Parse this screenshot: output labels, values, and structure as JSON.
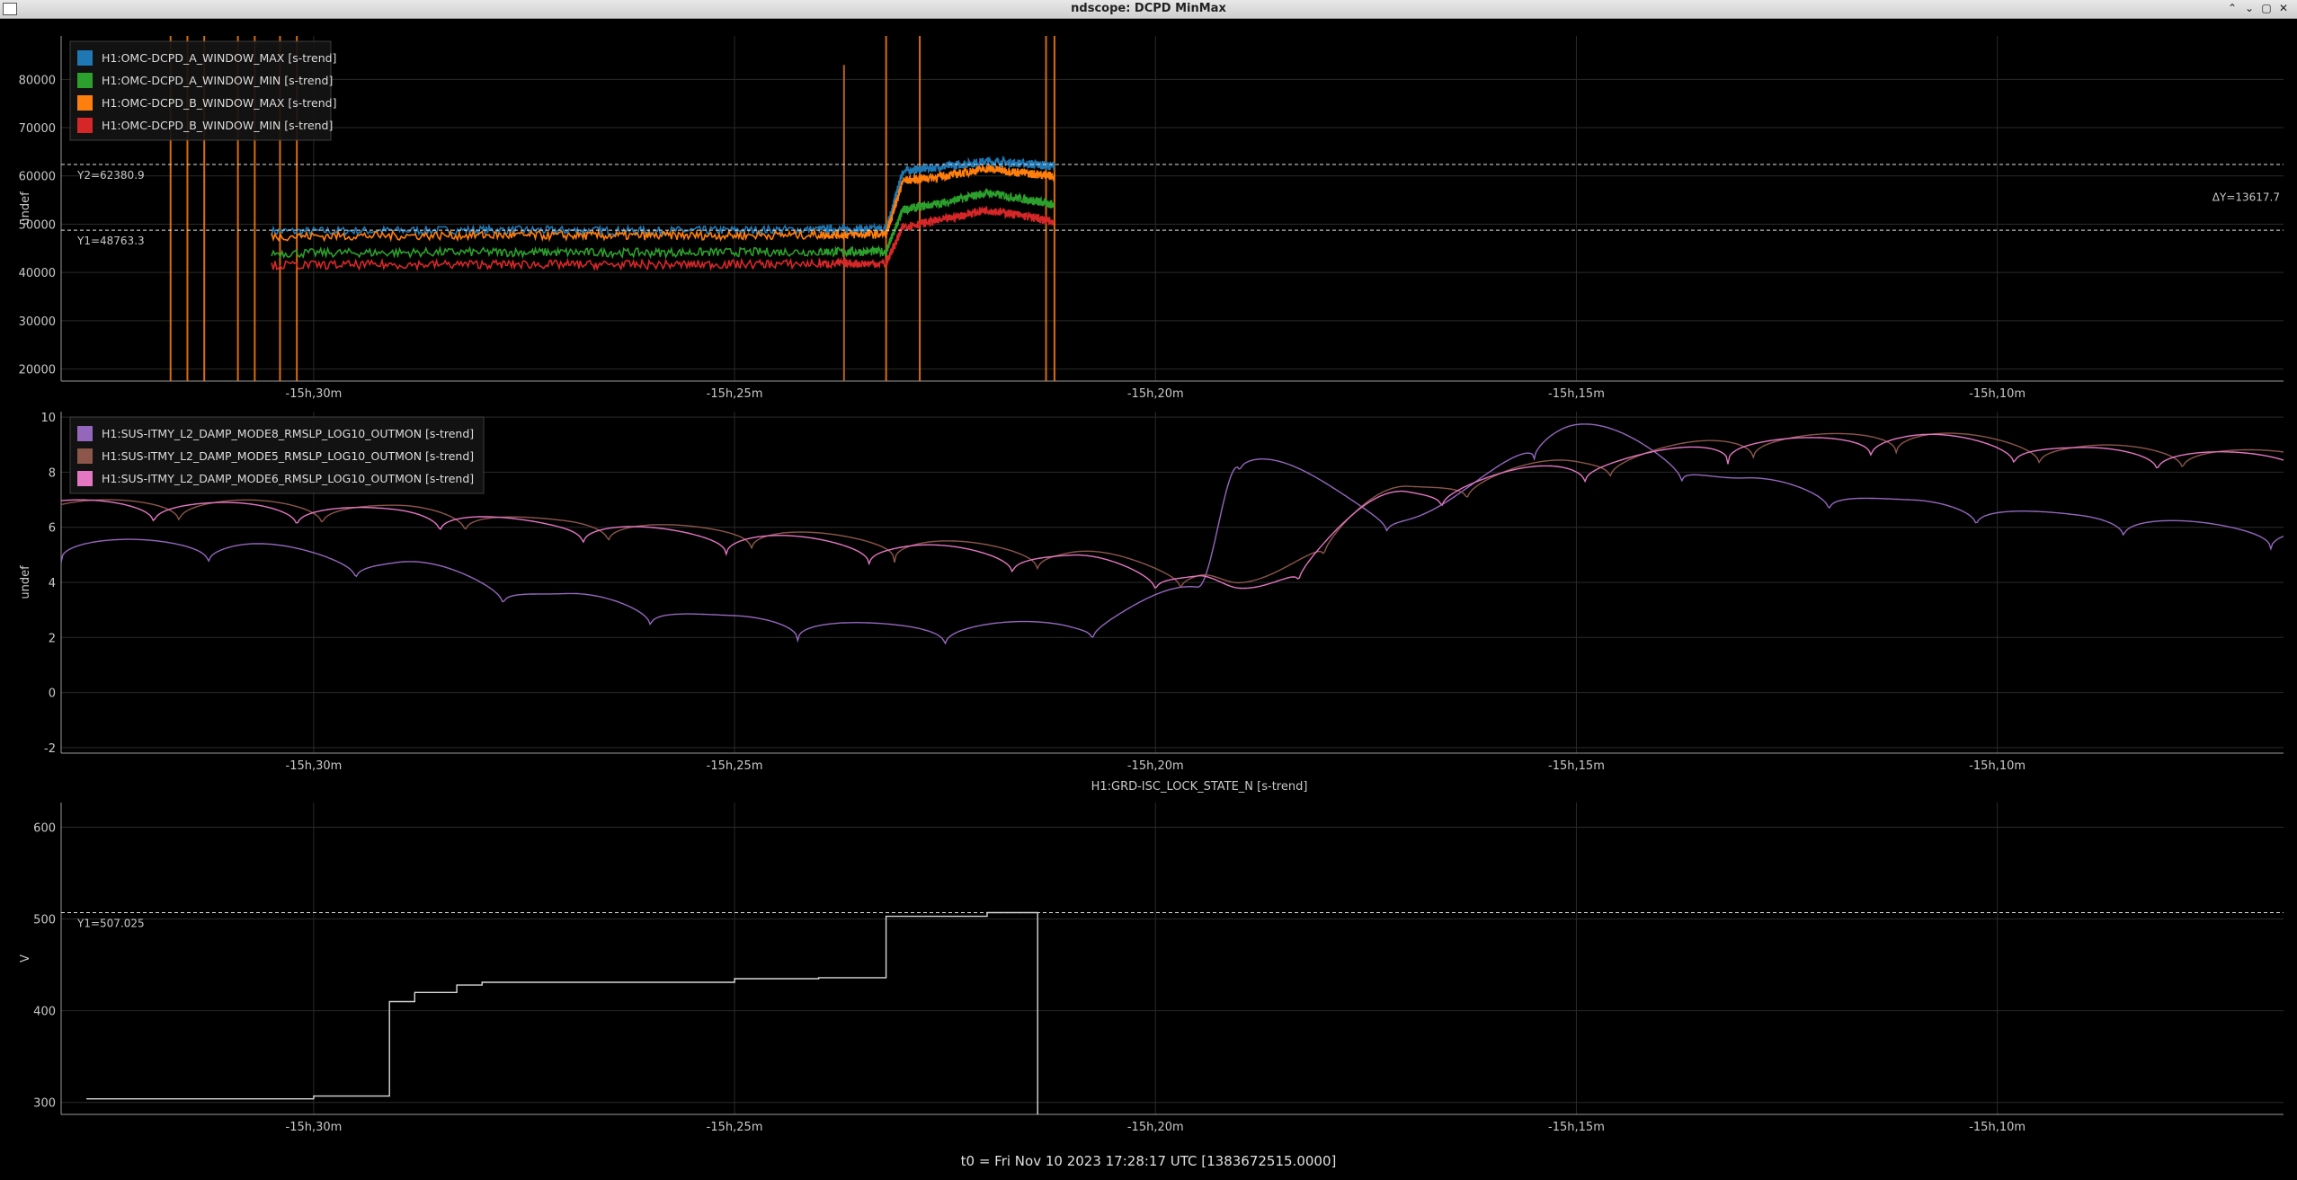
{
  "window": {
    "title": "ndscope: DCPD MinMax",
    "buttons": [
      "⌃",
      "⌄",
      "▢",
      "✕"
    ]
  },
  "footer": {
    "t0_text": "t0 = Fri Nov 10 2023 17:28:17 UTC [1383672515.0000]"
  },
  "colors": {
    "background": "#000000",
    "grid": "#2a2a2a",
    "axis": "#9a9a9a",
    "blue": "#1f77b4",
    "green": "#2ca02c",
    "orange": "#ff7f0e",
    "red": "#d62728",
    "purple": "#9467bd",
    "brown": "#8c564b",
    "pink": "#e377c2",
    "white": "#d8d8d8"
  },
  "chart_data": [
    {
      "type": "line",
      "title": "",
      "ylabel": "undef",
      "xlim_min": [
        -33.0,
        -6.6
      ],
      "ylim": [
        17500,
        89000
      ],
      "yticks": [
        20000,
        30000,
        40000,
        50000,
        60000,
        70000,
        80000
      ],
      "xticks": [
        {
          "v": -30,
          "label": "-15h,30m"
        },
        {
          "v": -25,
          "label": "-15h,25m"
        },
        {
          "v": -20,
          "label": "-15h,20m"
        },
        {
          "v": -15,
          "label": "-15h,15m"
        },
        {
          "v": -10,
          "label": "-15h,10m"
        }
      ],
      "legend": "top-left",
      "cursors": [
        {
          "y": 62380.9,
          "label": "Y2=62380.9"
        },
        {
          "y": 48763.3,
          "label": "Y1=48763.3"
        }
      ],
      "delta_label": "ΔY=13617.7",
      "series": [
        {
          "name": "H1:OMC-DCPD_A_WINDOW_MAX [s-trend]",
          "color": "#1f77b4",
          "x": [
            -30.5,
            -28,
            -26,
            -24,
            -23.2,
            -23.0,
            -22.5,
            -22,
            -21.5,
            -21.2
          ],
          "y": [
            48500,
            48800,
            48600,
            48900,
            49000,
            61000,
            62000,
            63000,
            62500,
            62000
          ]
        },
        {
          "name": "H1:OMC-DCPD_A_WINDOW_MIN [s-trend]",
          "color": "#2ca02c",
          "x": [
            -30.5,
            -28,
            -26,
            -24,
            -23.2,
            -23.0,
            -22.5,
            -22,
            -21.5,
            -21.2
          ],
          "y": [
            44000,
            44200,
            44100,
            44300,
            44300,
            53000,
            54500,
            56500,
            55000,
            54000
          ]
        },
        {
          "name": "H1:OMC-DCPD_B_WINDOW_MAX [s-trend]",
          "color": "#ff7f0e",
          "x": [
            -30.5,
            -28,
            -26,
            -24,
            -23.2,
            -23.0,
            -22.5,
            -22,
            -21.5,
            -21.2
          ],
          "y": [
            47500,
            47700,
            47600,
            47800,
            47900,
            59000,
            60000,
            61500,
            60500,
            60000
          ]
        },
        {
          "name": "H1:OMC-DCPD_B_WINDOW_MIN [s-trend]",
          "color": "#d62728",
          "x": [
            -30.5,
            -28,
            -26,
            -24,
            -23.2,
            -23.0,
            -22.5,
            -22,
            -21.5,
            -21.2
          ],
          "y": [
            41500,
            41700,
            41600,
            41800,
            41900,
            49500,
            51000,
            53000,
            51500,
            50500
          ]
        }
      ]
    },
    {
      "type": "line",
      "title": "",
      "ylabel": "undef",
      "xlim_min": [
        -33.0,
        -6.6
      ],
      "ylim": [
        -2.2,
        10.2
      ],
      "yticks": [
        -2,
        0,
        2,
        4,
        6,
        8,
        10
      ],
      "xticks": [
        {
          "v": -30,
          "label": "-15h,30m"
        },
        {
          "v": -25,
          "label": "-15h,25m"
        },
        {
          "v": -20,
          "label": "-15h,20m"
        },
        {
          "v": -15,
          "label": "-15h,15m"
        },
        {
          "v": -10,
          "label": "-15h,10m"
        }
      ],
      "legend": "top-left",
      "series": [
        {
          "name": "H1:SUS-ITMY_L2_DAMP_MODE8_RMSLP_LOG10_OUTMON [s-trend]",
          "color": "#9467bd",
          "x": [
            -33,
            -31,
            -29,
            -27,
            -25,
            -23,
            -21,
            -19.5,
            -19.0,
            -17,
            -15,
            -13,
            -11,
            -9,
            -6.6
          ],
          "y": [
            5.6,
            5.5,
            4.8,
            3.6,
            2.8,
            2.5,
            2.6,
            3.9,
            8.8,
            6.5,
            9.8,
            7.8,
            7.0,
            6.5,
            6.0
          ]
        },
        {
          "name": "H1:SUS-ITMY_L2_DAMP_MODE5_RMSLP_LOG10_OUTMON [s-trend]",
          "color": "#8c564b",
          "x": [
            -33,
            -31,
            -29,
            -27,
            -25,
            -23,
            -21,
            -19.5,
            -19.0,
            -17,
            -15,
            -13,
            -11,
            -9,
            -6.6
          ],
          "y": [
            7.0,
            7.0,
            6.8,
            6.3,
            6.0,
            5.6,
            5.2,
            4.5,
            4.0,
            7.5,
            8.5,
            9.3,
            9.5,
            9.0,
            8.8
          ]
        },
        {
          "name": "H1:SUS-ITMY_L2_DAMP_MODE6_RMSLP_LOG10_OUTMON [s-trend]",
          "color": "#e377c2",
          "x": [
            -33,
            -31,
            -29,
            -27,
            -25,
            -23,
            -21,
            -19.5,
            -19.0,
            -17,
            -15,
            -13,
            -11,
            -9,
            -6.6
          ],
          "y": [
            7.0,
            6.9,
            6.7,
            6.2,
            5.8,
            5.4,
            5.0,
            4.3,
            3.8,
            7.4,
            8.4,
            9.2,
            9.4,
            8.9,
            8.7
          ]
        }
      ]
    },
    {
      "type": "line",
      "title": "H1:GRD-ISC_LOCK_STATE_N [s-trend]",
      "ylabel": "V",
      "xlim_min": [
        -33.0,
        -6.6
      ],
      "ylim": [
        287,
        627
      ],
      "yticks": [
        300,
        400,
        500,
        600
      ],
      "xticks": [
        {
          "v": -30,
          "label": "-15h,30m"
        },
        {
          "v": -25,
          "label": "-15h,25m"
        },
        {
          "v": -20,
          "label": "-15h,20m"
        },
        {
          "v": -15,
          "label": "-15h,15m"
        },
        {
          "v": -10,
          "label": "-15h,10m"
        }
      ],
      "cursors": [
        {
          "y": 507.025,
          "label": "Y1=507.025"
        }
      ],
      "series": [
        {
          "name": "H1:GRD-ISC_LOCK_STATE_N",
          "color": "#d8d8d8",
          "x": [
            -32.7,
            -30.0,
            -30.0,
            -29.1,
            -29.1,
            -28.8,
            -28.8,
            -28.3,
            -28.3,
            -28.0,
            -28.0,
            -25.0,
            -25.0,
            -24.0,
            -24.0,
            -23.2,
            -23.2,
            -22.0,
            -22.0,
            -21.4,
            -21.4
          ],
          "y": [
            304,
            304,
            307,
            307,
            410,
            410,
            420,
            420,
            428,
            428,
            431,
            431,
            435,
            435,
            436,
            436,
            503,
            503,
            507,
            507,
            287
          ]
        }
      ]
    }
  ]
}
